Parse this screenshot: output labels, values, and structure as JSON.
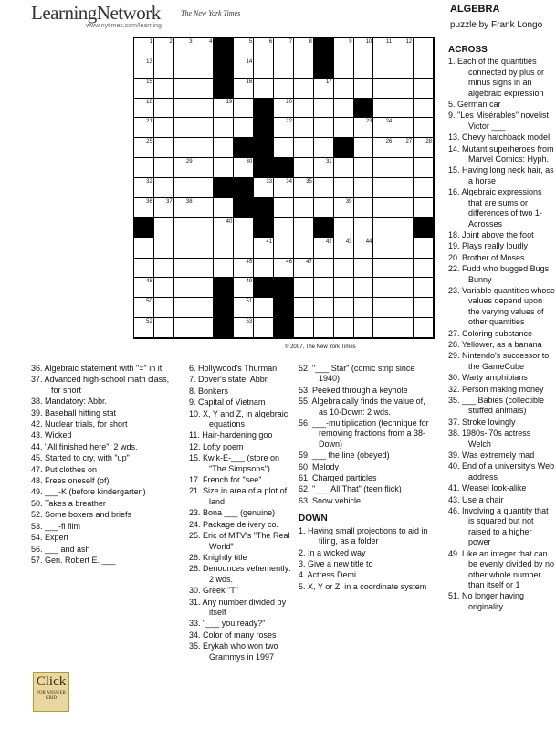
{
  "brand": {
    "name": "LearningNetwork",
    "tagline": "The New York Times",
    "url": "www.nytimes.com/learning"
  },
  "puzzle": {
    "title": "ALGEBRA",
    "byline": "puzzle by Frank Longo",
    "copyright": "© 2007, The New York Times"
  },
  "grid": [
    [
      "n:1",
      "n:2",
      "n:3",
      "n:4",
      "#",
      "n:5",
      "n:6",
      "n:7",
      "n:8",
      "#",
      "n:9",
      "n:10",
      "n:11",
      "n:12",
      ""
    ],
    [
      "n:13",
      "",
      "",
      "",
      "#",
      "n:14",
      "",
      "",
      "",
      "#",
      "",
      "",
      "",
      "",
      ""
    ],
    [
      "n:15",
      "",
      "",
      "",
      "#",
      "n:16",
      "",
      "",
      "",
      "n:17",
      "",
      "",
      "",
      "",
      ""
    ],
    [
      "n:18",
      "",
      "",
      "",
      "n:19",
      "",
      "#",
      "n:20",
      "",
      "",
      "",
      "#",
      "",
      "",
      ""
    ],
    [
      "n:21",
      "",
      "",
      "",
      "",
      "",
      "#",
      "n:22",
      "",
      "",
      "",
      "n:23",
      "n:24",
      "",
      ""
    ],
    [
      "n:25",
      "",
      "",
      "",
      "",
      "#",
      "#",
      "",
      "",
      "",
      "#",
      "",
      "n:26",
      "n:27",
      "n:28"
    ],
    [
      "",
      "",
      "n:29",
      "",
      "",
      "n:30",
      "#",
      "#",
      "",
      "n:31",
      "",
      "",
      "",
      "",
      ""
    ],
    [
      "n:32",
      "",
      "",
      "",
      "#",
      "#",
      "n:33",
      "n:34",
      "n:35",
      "",
      "",
      "",
      "",
      "",
      ""
    ],
    [
      "n:36",
      "n:37",
      "n:38",
      "",
      "",
      "#",
      "#",
      "",
      "",
      "",
      "n:39",
      "",
      "",
      "",
      ""
    ],
    [
      "#",
      "",
      "",
      "",
      "n:40",
      "",
      "#",
      "",
      "",
      "#",
      "",
      "",
      "",
      "",
      "#"
    ],
    [
      "",
      "",
      "",
      "",
      "",
      "",
      "n:41",
      "",
      "",
      "n:42",
      "n:43",
      "n:44",
      "",
      "",
      ""
    ],
    [
      "",
      "",
      "",
      "",
      "",
      "n:45",
      "",
      "n:46",
      "n:47",
      "",
      "",
      "",
      "",
      "",
      ""
    ],
    [
      "n:48",
      "",
      "",
      "",
      "#",
      "n:49",
      "#",
      "#",
      "",
      "",
      "",
      "",
      "",
      "",
      ""
    ],
    [
      "n:50",
      "",
      "",
      "",
      "#",
      "n:51",
      "",
      "#",
      "",
      "",
      "",
      "",
      "",
      "",
      ""
    ],
    [
      "n:52",
      "",
      "",
      "",
      "#",
      "n:53",
      "",
      "#",
      "",
      "",
      "",
      "",
      "",
      "",
      ""
    ]
  ],
  "across_header": "ACROSS",
  "across": [
    "1. Each of the quantities connected by plus or minus signs in an algebraic expression",
    "5. German car",
    "9. \"Les Misérables\" novelist Victor ___",
    "13. Chevy hatchback model",
    "14. Mutant superheroes from Marvel Comics: Hyph.",
    "15. Having long neck hair, as a horse",
    "16. Algebraic expressions that are sums or differences of two 1-Acrosses",
    "18. Joint above the foot",
    "19. Plays really loudly",
    "20. Brother of Moses",
    "22. Fudd who bugged Bugs Bunny",
    "23. Variable quantities whose values depend upon the varying values of other quantities",
    "27. Coloring substance",
    "28. Yellower, as a banana",
    "29. Nintendo's successor to the GameCube",
    "30. Warty amphibians",
    "32. Person making money",
    "35. ___ Babies (collectible stuffed animals)",
    "37. Stroke lovingly",
    "38. 1980s-'70s actress Welch",
    "39. Was extremely mad",
    "40. End of a university's Web address",
    "41. Weasel look-alike",
    "43. Use a chair",
    "46. Involving a quantity that is squared but not raised to a higher power",
    "49. Like an integer that can be evenly divided by no other whole number than itself or 1",
    "51. No longer having originality",
    "52. \"___ Star\" (comic strip since 1940)",
    "53. Peeked through a keyhole",
    "55. Algebraically finds the value of, as 10-Down: 2 wds.",
    "56. ___-multiplication (technique for removing fractions from a 38-Down)",
    "59. ___ the line (obeyed)",
    "60. Melody",
    "61. Charged particles",
    "62. \"___ All That\" (teen flick)",
    "63. Snow vehicle"
  ],
  "down_header": "DOWN",
  "down": [
    "1. Having small projections to aid in tiling, as a folder",
    "2. In a wicked way",
    "3. Give a new title to",
    "4. Actress Demi",
    "5. X, Y or Z, in a coordinate system",
    "6. Hollywood's Thurman",
    "7. Dover's state: Abbr.",
    "8. Bonkers",
    "9. Capital of Vietnam",
    "10. X, Y and Z, in algebraic equations",
    "11. Hair-hardening goo",
    "12. Lofty poem",
    "15. Kwik-E-___ (store on \"The Simpsons\")",
    "17. French for \"see\"",
    "21. Size in area of a plot of land",
    "23. Bona ___ (genuine)",
    "24. Package delivery co.",
    "25. Eric of MTV's \"The Real World\"",
    "26. Knightly title",
    "28. Denounces vehemently: 2 wds.",
    "30. Greek \"T\"",
    "31. Any number divided by itself",
    "33. \"___ you ready?\"",
    "34. Color of many roses",
    "35. Erykah who won two Grammys in 1997",
    "36. Algebraic statement with \"=\" in it",
    "37. Advanced high-school math class, for short",
    "38. Mandatory: Abbr.",
    "39. Baseball hitting stat",
    "42. Nuclear trials, for short",
    "43. Wicked",
    "44. \"All finished here\": 2 wds.",
    "45. Started to cry, with \"up\"",
    "47. Put clothes on",
    "48. Frees oneself (of)",
    "49. ___-K (before kindergarten)",
    "50. Takes a breather",
    "52. Some boxers and briefs",
    "53. ___-fi film",
    "54. Expert",
    "56. ___ and ash",
    "57. Gen. Robert E. ___"
  ],
  "click": {
    "line1": "Click",
    "line2": "FOR ANSWER",
    "line3": "GRID"
  }
}
